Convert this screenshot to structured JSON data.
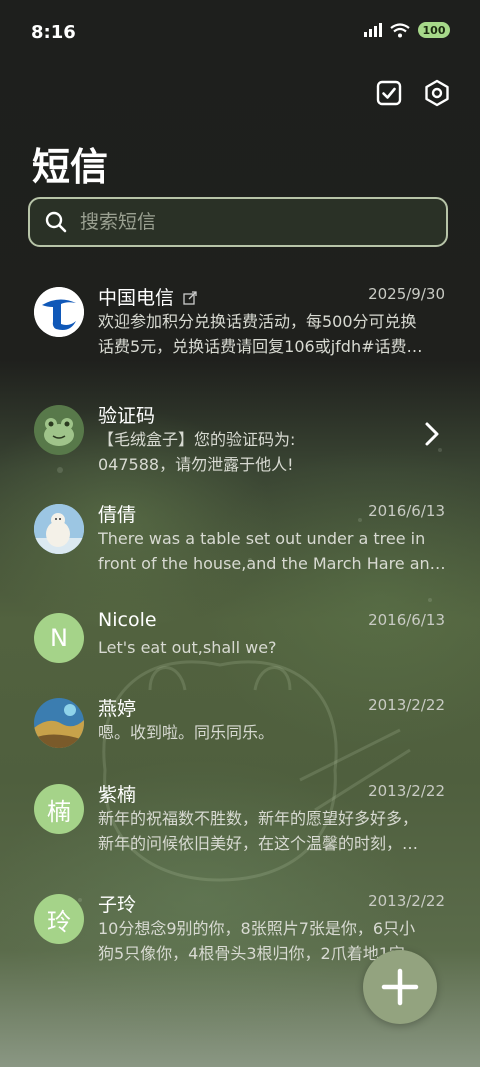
{
  "status_bar": {
    "time": "8:16",
    "battery": "100"
  },
  "page_title": "短信",
  "search": {
    "placeholder": "搜索短信"
  },
  "conversations": [
    {
      "name": "中国电信",
      "date": "2025/9/30",
      "preview_line1": "欢迎参加积分兑换话费活动，每500分可兑换",
      "preview_line2": "话费5元，兑换话费请回复106或jfdh#话费…"
    },
    {
      "name": "验证码",
      "date": "",
      "preview_line1": "【毛绒盒子】您的验证码为:",
      "preview_line2": "047588，请勿泄露于他人!"
    },
    {
      "name": "倩倩",
      "date": "2016/6/13",
      "preview_line1": "There was a table set out under a tree in",
      "preview_line2": "front of the house,and the March Hare an…"
    },
    {
      "name": "Nicole",
      "date": "2016/6/13",
      "avatar_letter": "N",
      "preview_line1": "Let's eat out,shall we?",
      "preview_line2": ""
    },
    {
      "name": "燕婷",
      "date": "2013/2/22",
      "preview_line1": "嗯。收到啦。同乐同乐。",
      "preview_line2": ""
    },
    {
      "name": "紫楠",
      "date": "2013/2/22",
      "avatar_letter": "楠",
      "preview_line1": "新年的祝福数不胜数，新年的愿望好多好多，",
      "preview_line2": "新年的问候依旧美好，在这个温馨的时刻，…"
    },
    {
      "name": "子玲",
      "date": "2013/2/22",
      "avatar_letter": "玲",
      "preview_line1": "10分想念9别的你，8张照片7张是你，6只小",
      "preview_line2": "狗5只像你，4根骨头3根归你，2爪着地1定…"
    }
  ],
  "icons": {
    "toolbar": [
      "checkbox-icon",
      "settings-hexagon-icon"
    ],
    "fab": "plus-icon",
    "search": "search-icon",
    "chevron": "chevron-right-icon"
  },
  "colors": {
    "accent": "#a5d389",
    "fab": "#93a37f",
    "search_border": "#b7c4a8"
  }
}
